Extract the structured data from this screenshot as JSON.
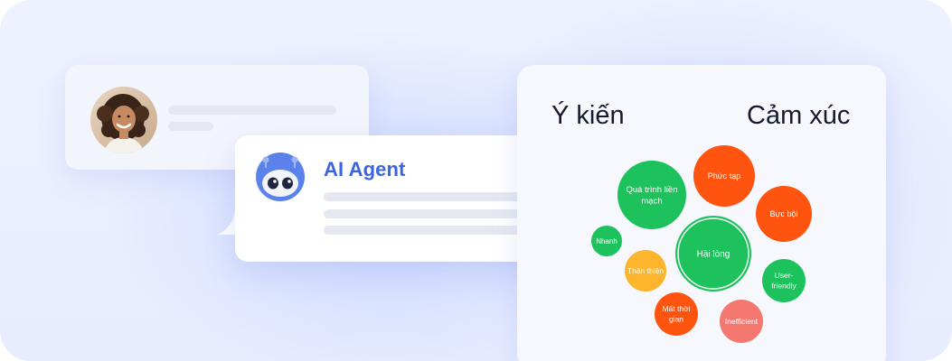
{
  "agent": {
    "title": "AI Agent"
  },
  "panel": {
    "left_title": "Ý kiến",
    "right_title": "Cảm xúc"
  },
  "colors": {
    "positive": "#1ec25c",
    "negative": "#ff5410",
    "neutral": "#fdb52e",
    "soft_negative": "#f47770",
    "agent_blue": "#3b64de"
  },
  "bubbles": [
    {
      "lines": [
        "Quá trình liền",
        "mạch"
      ],
      "sentiment": "positive"
    },
    {
      "lines": [
        "Phức tạp"
      ],
      "sentiment": "negative"
    },
    {
      "lines": [
        "Bực bội"
      ],
      "sentiment": "negative"
    },
    {
      "lines": [
        "Nhanh"
      ],
      "sentiment": "positive"
    },
    {
      "lines": [
        "Hài lòng"
      ],
      "sentiment": "positive"
    },
    {
      "lines": [
        "Thân thiện"
      ],
      "sentiment": "neutral"
    },
    {
      "lines": [
        "User-",
        "friendly"
      ],
      "sentiment": "positive"
    },
    {
      "lines": [
        "Mất thời",
        "gian"
      ],
      "sentiment": "negative"
    },
    {
      "lines": [
        "Inefficient"
      ],
      "sentiment": "soft_negative"
    }
  ]
}
